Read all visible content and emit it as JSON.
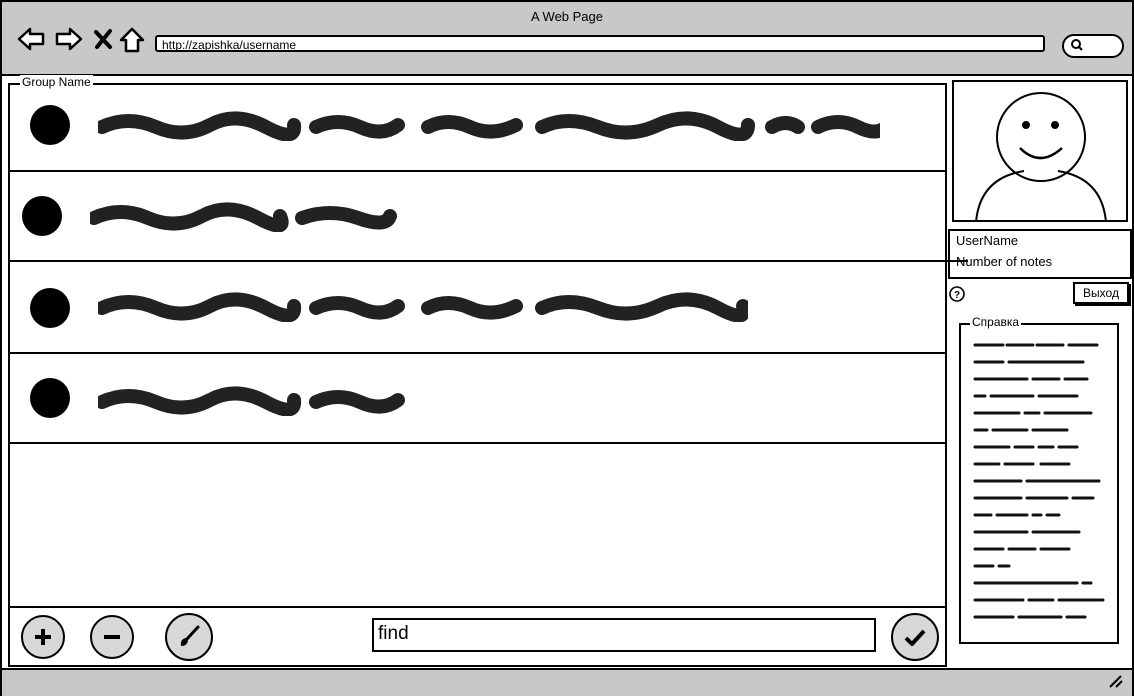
{
  "window": {
    "title": "A Web Page"
  },
  "browser": {
    "url": "http://zapishka/username"
  },
  "group": {
    "name": "Group Name",
    "items": [
      {
        "icon": "bullet-icon"
      },
      {
        "icon": "bullet-icon"
      },
      {
        "icon": "bullet-icon"
      },
      {
        "icon": "bullet-icon"
      }
    ]
  },
  "toolbar": {
    "add_icon": "plus-icon",
    "remove_icon": "minus-icon",
    "edit_icon": "brush-icon",
    "find_value": "find",
    "confirm_icon": "check-icon"
  },
  "user": {
    "name": "UserName",
    "notes": "Number of notes",
    "logout": "Выход"
  },
  "help": {
    "title": "Справка",
    "icon": "question-icon"
  },
  "colors": {
    "chrome": "#c8c8c8",
    "button_fill": "#d8d8d8",
    "ink": "#000000"
  }
}
